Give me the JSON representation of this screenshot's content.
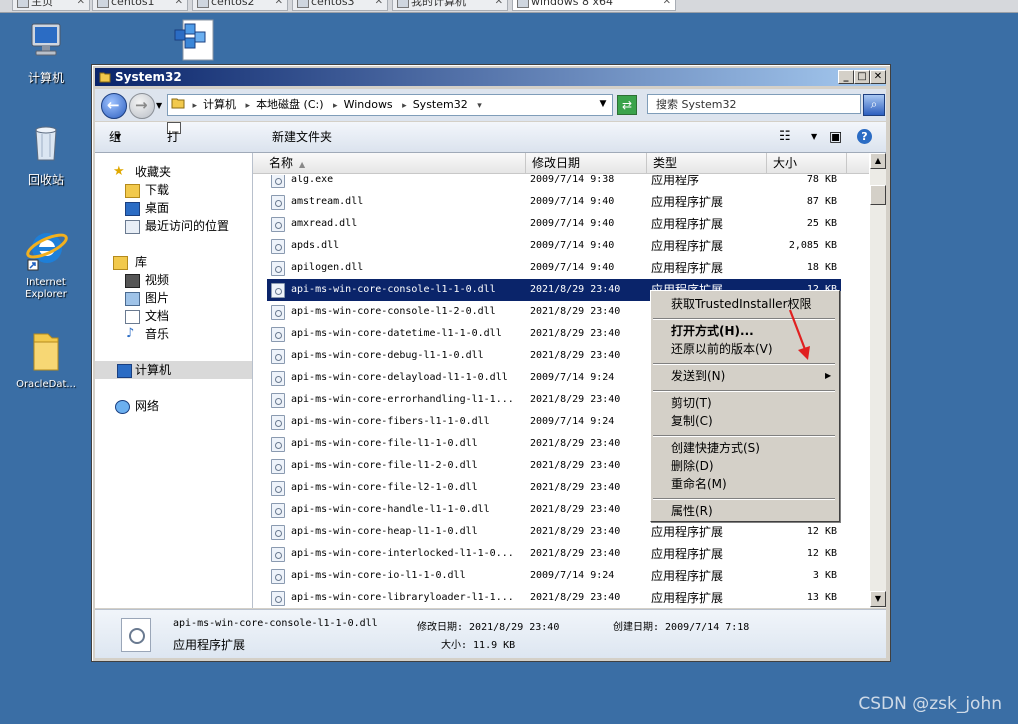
{
  "vm_tabs": [
    {
      "label": "主页"
    },
    {
      "label": "centos1"
    },
    {
      "label": "centos2"
    },
    {
      "label": "centos3"
    },
    {
      "label": "我的计算机"
    },
    {
      "label": "windows 8 x64"
    }
  ],
  "desktop_icons": [
    {
      "label": "计算机",
      "icon": "computer-icon"
    },
    {
      "label": "回收站",
      "icon": "recycle-bin-icon"
    },
    {
      "label": "Internet Explorer",
      "icon": "ie-icon"
    },
    {
      "label": "OracleDat...",
      "icon": "folder-icon"
    },
    {
      "label": "",
      "icon": "registry-editor-icon"
    }
  ],
  "window": {
    "title": "System32",
    "breadcrumb": [
      "计算机",
      "本地磁盘 (C:)",
      "Windows",
      "System32"
    ],
    "search_placeholder": "搜索 System32",
    "toolbar": {
      "organize": "组织",
      "open_with": "打开方式...",
      "new_folder": "新建文件夹"
    },
    "nav": {
      "favorites": "收藏夹",
      "downloads": "下载",
      "desktop": "桌面",
      "recent": "最近访问的位置",
      "libraries": "库",
      "videos": "视频",
      "pictures": "图片",
      "documents": "文档",
      "music": "音乐",
      "computer": "计算机",
      "network": "网络"
    },
    "columns": {
      "name": "名称",
      "date": "修改日期",
      "type": "类型",
      "size": "大小"
    },
    "files": [
      {
        "name": "alg.exe",
        "date": "2009/7/14 9:38",
        "type": "应用程序",
        "size": "78 KB"
      },
      {
        "name": "amstream.dll",
        "date": "2009/7/14 9:40",
        "type": "应用程序扩展",
        "size": "87 KB"
      },
      {
        "name": "amxread.dll",
        "date": "2009/7/14 9:40",
        "type": "应用程序扩展",
        "size": "25 KB"
      },
      {
        "name": "apds.dll",
        "date": "2009/7/14 9:40",
        "type": "应用程序扩展",
        "size": "2,085 KB"
      },
      {
        "name": "apilogen.dll",
        "date": "2009/7/14 9:40",
        "type": "应用程序扩展",
        "size": "18 KB"
      },
      {
        "name": "api-ms-win-core-console-l1-1-0.dll",
        "date": "2021/8/29 23:40",
        "type": "应用程序扩展",
        "size": "12 KB",
        "selected": true
      },
      {
        "name": "api-ms-win-core-console-l1-2-0.dll",
        "date": "2021/8/29 23:40",
        "type": "",
        "size": ""
      },
      {
        "name": "api-ms-win-core-datetime-l1-1-0.dll",
        "date": "2021/8/29 23:40",
        "type": "",
        "size": ""
      },
      {
        "name": "api-ms-win-core-debug-l1-1-0.dll",
        "date": "2021/8/29 23:40",
        "type": "",
        "size": ""
      },
      {
        "name": "api-ms-win-core-delayload-l1-1-0.dll",
        "date": "2009/7/14 9:24",
        "type": "",
        "size": ""
      },
      {
        "name": "api-ms-win-core-errorhandling-l1-1...",
        "date": "2021/8/29 23:40",
        "type": "",
        "size": ""
      },
      {
        "name": "api-ms-win-core-fibers-l1-1-0.dll",
        "date": "2009/7/14 9:24",
        "type": "",
        "size": ""
      },
      {
        "name": "api-ms-win-core-file-l1-1-0.dll",
        "date": "2021/8/29 23:40",
        "type": "",
        "size": ""
      },
      {
        "name": "api-ms-win-core-file-l1-2-0.dll",
        "date": "2021/8/29 23:40",
        "type": "",
        "size": ""
      },
      {
        "name": "api-ms-win-core-file-l2-1-0.dll",
        "date": "2021/8/29 23:40",
        "type": "",
        "size": ""
      },
      {
        "name": "api-ms-win-core-handle-l1-1-0.dll",
        "date": "2021/8/29 23:40",
        "type": "",
        "size": ""
      },
      {
        "name": "api-ms-win-core-heap-l1-1-0.dll",
        "date": "2021/8/29 23:40",
        "type": "应用程序扩展",
        "size": "12 KB"
      },
      {
        "name": "api-ms-win-core-interlocked-l1-1-0...",
        "date": "2021/8/29 23:40",
        "type": "应用程序扩展",
        "size": "12 KB"
      },
      {
        "name": "api-ms-win-core-io-l1-1-0.dll",
        "date": "2009/7/14 9:24",
        "type": "应用程序扩展",
        "size": "3 KB"
      },
      {
        "name": "api-ms-win-core-libraryloader-l1-1...",
        "date": "2021/8/29 23:40",
        "type": "应用程序扩展",
        "size": "13 KB"
      }
    ],
    "details": {
      "filename": "api-ms-win-core-console-l1-1-0.dll",
      "modified": "修改日期: 2021/8/29 23:40",
      "created": "创建日期: 2009/7/14 7:18",
      "type": "应用程序扩展",
      "size": "大小: 11.9 KB"
    }
  },
  "context_menu": {
    "items": [
      {
        "label": "获取TrustedInstaller权限",
        "bold": false,
        "group": 0
      },
      {
        "label": "打开方式(H)...",
        "bold": true,
        "group": 1
      },
      {
        "label": "还原以前的版本(V)",
        "bold": false,
        "group": 1
      },
      {
        "label": "发送到(N)",
        "bold": false,
        "group": 2,
        "submenu": true
      },
      {
        "label": "剪切(T)",
        "bold": false,
        "group": 3
      },
      {
        "label": "复制(C)",
        "bold": false,
        "group": 3
      },
      {
        "label": "创建快捷方式(S)",
        "bold": false,
        "group": 4
      },
      {
        "label": "删除(D)",
        "bold": false,
        "group": 4
      },
      {
        "label": "重命名(M)",
        "bold": false,
        "group": 4
      },
      {
        "label": "属性(R)",
        "bold": false,
        "group": 5
      }
    ]
  },
  "watermark": "CSDN @zsk_john",
  "colors": {
    "desktop": "#3a6ea5",
    "selection": "#0a246a",
    "annotation_arrow": "#e02020"
  }
}
